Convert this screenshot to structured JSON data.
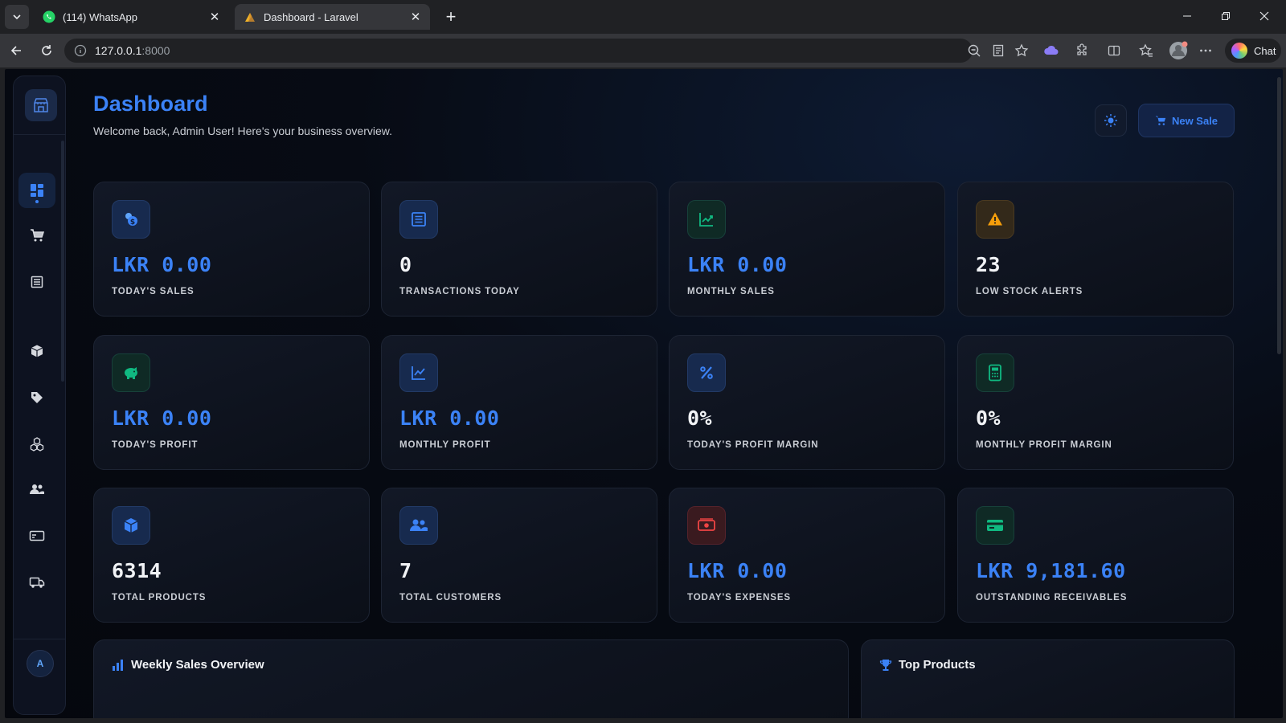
{
  "browser": {
    "tabs": [
      {
        "title": "(114) WhatsApp",
        "icon": "whatsapp-icon"
      },
      {
        "title": "Dashboard - Laravel",
        "icon": "laravel-icon"
      }
    ],
    "url_host": "127.0.0.1",
    "url_port": ":8000",
    "chat_label": "Chat"
  },
  "header": {
    "title": "Dashboard",
    "subtitle": "Welcome back, Admin User! Here's your business overview.",
    "new_sale_label": "New Sale"
  },
  "sidebar": {
    "avatar_initial": "A",
    "items": [
      {
        "name": "dashboard",
        "icon": "dashboard-icon",
        "active": true
      },
      {
        "name": "pos",
        "icon": "cart-icon"
      },
      {
        "name": "sales",
        "icon": "receipt-icon"
      },
      {
        "name": "products",
        "icon": "box-icon"
      },
      {
        "name": "categories",
        "icon": "tag-icon"
      },
      {
        "name": "inventory",
        "icon": "cubes-icon"
      },
      {
        "name": "customers",
        "icon": "users-icon"
      },
      {
        "name": "payments",
        "icon": "card-icon"
      },
      {
        "name": "suppliers",
        "icon": "truck-icon"
      }
    ]
  },
  "stats": [
    {
      "value": "LKR 0.00",
      "label": "Today's Sales",
      "icon": "coins-icon",
      "tone": "blue"
    },
    {
      "value": "0",
      "label": "Transactions Today",
      "icon": "receipt-icon",
      "tone": "blue"
    },
    {
      "value": "LKR 0.00",
      "label": "Monthly Sales",
      "icon": "chart-line-icon",
      "tone": "green"
    },
    {
      "value": "23",
      "label": "Low Stock Alerts",
      "icon": "warning-icon",
      "tone": "amber"
    },
    {
      "value": "LKR 0.00",
      "label": "Today's Profit",
      "icon": "piggy-bank-icon",
      "tone": "green"
    },
    {
      "value": "LKR 0.00",
      "label": "Monthly Profit",
      "icon": "chart-line-icon",
      "tone": "blue"
    },
    {
      "value": "0%",
      "label": "Today's Profit Margin",
      "icon": "percent-icon",
      "tone": "blue"
    },
    {
      "value": "0%",
      "label": "Monthly Profit Margin",
      "icon": "calculator-icon",
      "tone": "green"
    },
    {
      "value": "6314",
      "label": "Total Products",
      "icon": "box-icon",
      "tone": "blue"
    },
    {
      "value": "7",
      "label": "Total Customers",
      "icon": "users-icon",
      "tone": "blue"
    },
    {
      "value": "LKR 0.00",
      "label": "Today's Expenses",
      "icon": "money-icon",
      "tone": "red"
    },
    {
      "value": "LKR 9,181.60",
      "label": "Outstanding Receivables",
      "icon": "card-icon",
      "tone": "green"
    }
  ],
  "panels": {
    "weekly": "Weekly Sales Overview",
    "top_products": "Top Products"
  },
  "colors": {
    "accent": "#3b82f6",
    "green": "#10b981",
    "amber": "#f59e0b",
    "red": "#ef4444"
  }
}
